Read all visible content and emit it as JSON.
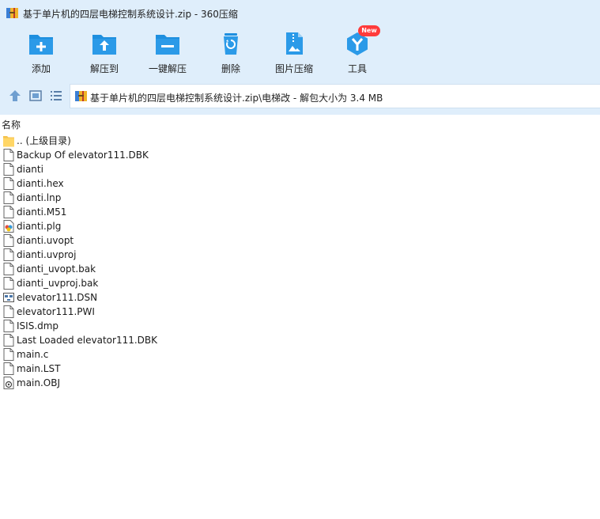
{
  "window": {
    "title": "基于单片机的四层电梯控制系统设计.zip - 360压缩"
  },
  "toolbar": {
    "buttons": [
      {
        "label": "添加",
        "icon": "add-folder-icon"
      },
      {
        "label": "解压到",
        "icon": "extract-to-icon"
      },
      {
        "label": "一键解压",
        "icon": "one-click-extract-icon"
      },
      {
        "label": "删除",
        "icon": "delete-bin-icon"
      },
      {
        "label": "图片压缩",
        "icon": "image-compress-icon"
      },
      {
        "label": "工具",
        "icon": "tools-icon"
      }
    ],
    "new_badge": "New"
  },
  "nav": {
    "path": "基于单片机的四层电梯控制系统设计.zip\\电梯改 - 解包大小为 3.4 MB"
  },
  "columns": {
    "name": "名称"
  },
  "files": [
    {
      "name": ".. (上级目录)",
      "icon": "folder-icon"
    },
    {
      "name": "Backup Of elevator111.DBK",
      "icon": "file-icon"
    },
    {
      "name": "dianti",
      "icon": "file-icon"
    },
    {
      "name": "dianti.hex",
      "icon": "file-icon"
    },
    {
      "name": "dianti.lnp",
      "icon": "file-icon"
    },
    {
      "name": "dianti.M51",
      "icon": "file-icon"
    },
    {
      "name": "dianti.plg",
      "icon": "plg-file-icon"
    },
    {
      "name": "dianti.uvopt",
      "icon": "file-icon"
    },
    {
      "name": "dianti.uvproj",
      "icon": "file-icon"
    },
    {
      "name": "dianti_uvopt.bak",
      "icon": "file-icon"
    },
    {
      "name": "dianti_uvproj.bak",
      "icon": "file-icon"
    },
    {
      "name": "elevator111.DSN",
      "icon": "dsn-file-icon"
    },
    {
      "name": "elevator111.PWI",
      "icon": "file-icon"
    },
    {
      "name": "ISIS.dmp",
      "icon": "file-icon"
    },
    {
      "name": "Last Loaded elevator111.DBK",
      "icon": "file-icon"
    },
    {
      "name": "main.c",
      "icon": "file-icon"
    },
    {
      "name": "main.LST",
      "icon": "file-icon"
    },
    {
      "name": "main.OBJ",
      "icon": "obj-file-icon"
    }
  ],
  "colors": {
    "header_bg": "#dfeefb",
    "icon_blue": "#1e8fdf",
    "badge_red": "#ff3b3b"
  }
}
